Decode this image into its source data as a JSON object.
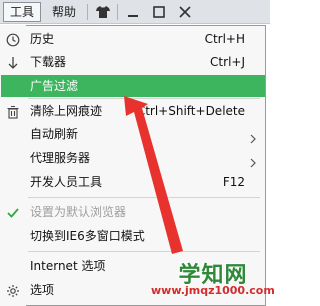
{
  "toolbar": {
    "tools_label": "工具",
    "help_label": "帮助"
  },
  "menu": {
    "items": [
      {
        "label": "历史",
        "shortcut": "Ctrl+H",
        "icon": "history-clock-icon"
      },
      {
        "label": "下载器",
        "shortcut": "Ctrl+J",
        "icon": "download-arrow-icon"
      },
      {
        "label": "广告过滤",
        "shortcut": "",
        "icon": "",
        "highlighted": true
      },
      {
        "label": "清除上网痕迹",
        "shortcut": "Ctrl+Shift+Delete",
        "icon": "trash-icon"
      },
      {
        "label": "自动刷新",
        "shortcut": "",
        "submenu": true
      },
      {
        "label": "代理服务器",
        "shortcut": "",
        "submenu": true
      },
      {
        "label": "开发人员工具",
        "shortcut": "F12"
      },
      {
        "label": "设置为默认浏览器",
        "shortcut": "",
        "disabled": true,
        "icon": "checkmark-icon"
      },
      {
        "label": "切换到IE6多窗口模式",
        "shortcut": ""
      },
      {
        "label": "Internet 选项",
        "shortcut": ""
      },
      {
        "label": "选项",
        "shortcut": "",
        "icon": "gear-icon"
      }
    ]
  },
  "watermark": {
    "title": "学知网",
    "url": "www.jmqz1000.com"
  },
  "colors": {
    "highlight": "#3cb55e",
    "annotation_arrow": "#e8322e"
  }
}
